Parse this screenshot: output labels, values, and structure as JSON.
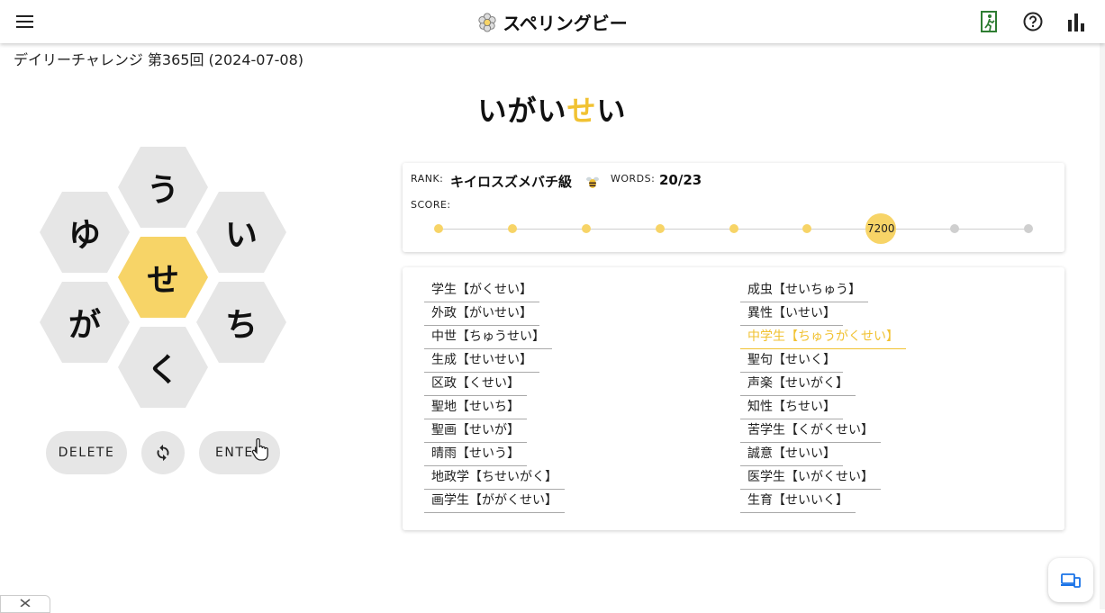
{
  "header": {
    "title": "スペリングビー",
    "icons": [
      "menu-icon",
      "bee-flower-icon",
      "exit-icon",
      "help-icon",
      "stats-icon"
    ]
  },
  "challenge": {
    "label": "デイリーチャレンジ 第365回 (2024-07-08)"
  },
  "current_word": {
    "prefix": "いがい",
    "center_letter": "せ",
    "suffix": "い"
  },
  "board": {
    "center": "せ",
    "outer": {
      "top": "う",
      "upper_left": "ゆ",
      "upper_right": "い",
      "lower_left": "が",
      "lower_right": "ち",
      "bottom": "く"
    }
  },
  "buttons": {
    "delete": "DELETE",
    "enter": "ENTER",
    "shuffle_icon": "shuffle-icon"
  },
  "progress": {
    "rank_label": "RANK:",
    "rank_value": "キイロスズメバチ級",
    "rank_icon": "hornet-icon",
    "words_label": "WORDS:",
    "words_value": "20/23",
    "score_label": "SCORE:",
    "score_value": "7200",
    "levels_total": 9,
    "current_level_index": 6
  },
  "found_words": {
    "left": [
      "学生【がくせい】",
      "外政【がいせい】",
      "中世【ちゅうせい】",
      "生成【せいせい】",
      "区政【くせい】",
      "聖地【せいち】",
      "聖画【せいが】",
      "晴雨【せいう】",
      "地政学【ちせいがく】",
      "画学生【ががくせい】"
    ],
    "right": [
      "成虫【せいちゅう】",
      "異性【いせい】",
      "中学生【ちゅうがくせい】",
      "聖句【せいく】",
      "声楽【せいがく】",
      "知性【ちせい】",
      "苦学生【くがくせい】",
      "誠意【せいい】",
      "医学生【いがくせい】",
      "生育【せいいく】"
    ],
    "highlighted": "中学生【ちゅうがくせい】"
  },
  "colors": {
    "accent": "#f7d467",
    "accent_text": "#f1c232",
    "tile": "#e6e6e6",
    "exit_icon": "#2e7d32"
  }
}
